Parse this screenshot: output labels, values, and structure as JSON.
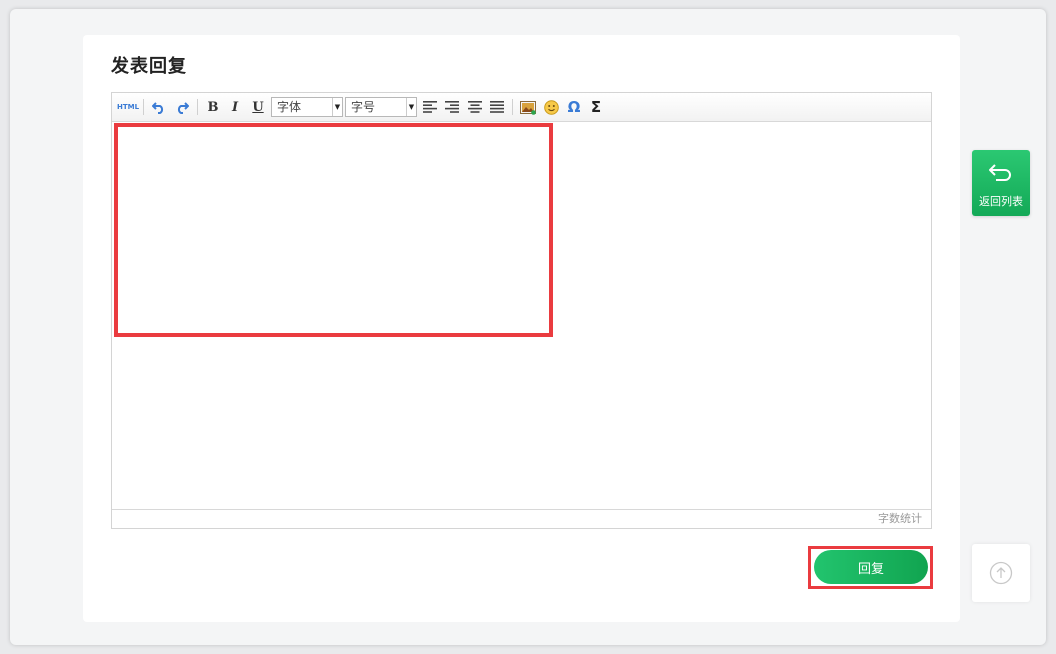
{
  "page": {
    "title": "发表回复"
  },
  "toolbar": {
    "html_label": "HTML",
    "bold_label": "B",
    "italic_label": "I",
    "underline_label": "U",
    "font_family": "字体",
    "font_size": "字号",
    "special_char_label": "Ω",
    "formula_label": "Σ"
  },
  "editor": {
    "word_count_label": "字数统计"
  },
  "actions": {
    "reply_label": "回复"
  },
  "sidebar": {
    "back_to_list_label": "返回列表"
  },
  "colors": {
    "accent_green": "#1dbb63",
    "highlight_red": "#ea3b3f",
    "link_blue": "#3a7bd5"
  }
}
